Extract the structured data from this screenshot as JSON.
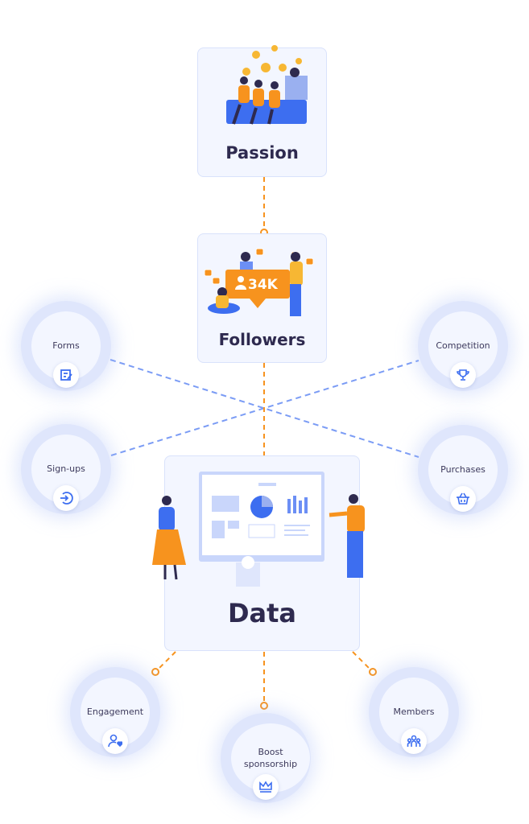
{
  "cards": {
    "passion": {
      "title": "Passion"
    },
    "followers": {
      "title": "Followers",
      "badge": "34K"
    },
    "data": {
      "title": "Data"
    }
  },
  "nodes": {
    "forms": {
      "label": "Forms",
      "icon": "form-edit-icon"
    },
    "signups": {
      "label": "Sign-ups",
      "icon": "sign-in-icon"
    },
    "competition": {
      "label": "Competition",
      "icon": "trophy-icon"
    },
    "purchases": {
      "label": "Purchases",
      "icon": "basket-icon"
    },
    "engagement": {
      "label": "Engagement",
      "icon": "user-heart-icon"
    },
    "boost": {
      "label": "Boost sponsorship",
      "icon": "crown-icon"
    },
    "members": {
      "label": "Members",
      "icon": "group-icon"
    }
  },
  "colors": {
    "accent_orange": "#f7931e",
    "accent_blue": "#3d6ef0",
    "dashed_blue": "#7b9cf5",
    "title": "#2e2a4f"
  }
}
